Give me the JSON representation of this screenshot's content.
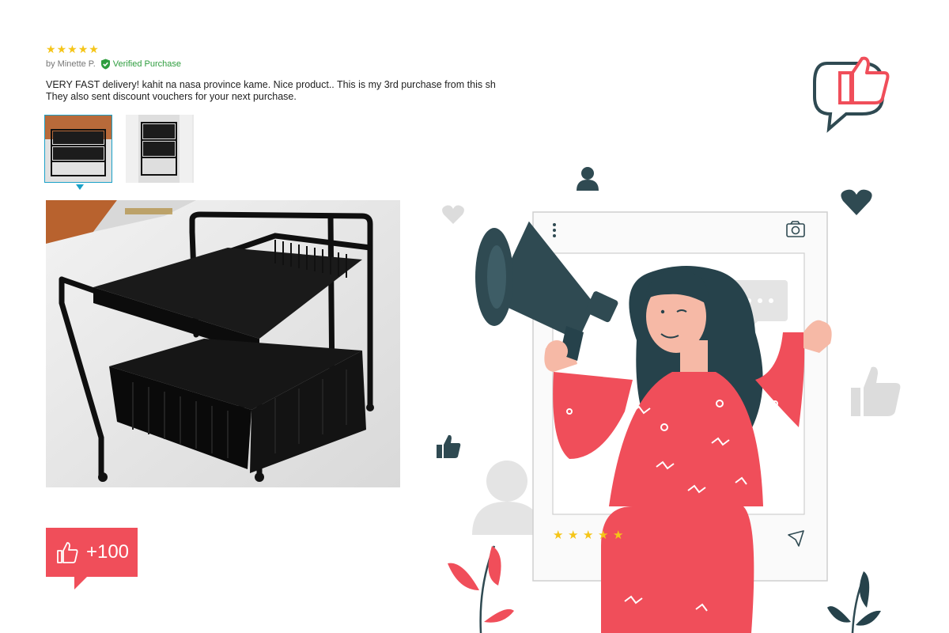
{
  "review": {
    "rating": 5,
    "star_glyph": "★",
    "author": "by Minette P.",
    "verified_label": "Verified Purchase",
    "text_line1": "VERY FAST delivery!  kahit na nasa province kame. Nice product.. This is my 3rd purchase from this sh",
    "text_line2": "They also sent discount vouchers for your next purchase.",
    "thumbnails": [
      {
        "name": "thumbnail-1",
        "selected": true
      },
      {
        "name": "thumbnail-2",
        "selected": false
      }
    ]
  },
  "badge": {
    "icon": "thumbs-up-icon",
    "count_label": "+100"
  },
  "illustration": {
    "post_rating": 5,
    "accent": "#f04e5a",
    "dark": "#2f4a52",
    "gray": "#e4e4e4",
    "star_color": "#f5c518"
  }
}
